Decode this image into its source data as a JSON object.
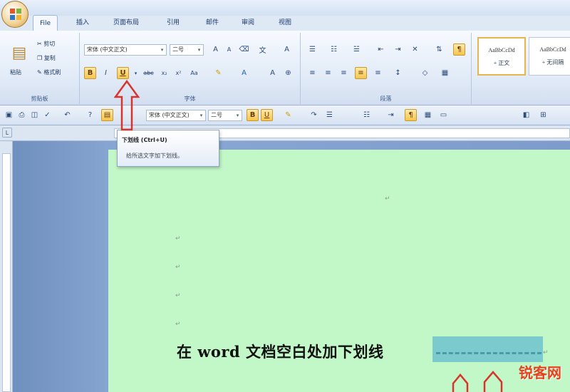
{
  "tabs": {
    "file": "File",
    "insert": "插入",
    "layout": "页面布局",
    "references": "引用",
    "mailings": "邮件",
    "review": "审阅",
    "view": "视图"
  },
  "clipboard": {
    "paste": "粘贴",
    "cut": "剪切",
    "copy": "复制",
    "format_painter": "格式刷",
    "group_label": "剪贴板"
  },
  "font": {
    "name": "宋体 (中文正文)",
    "size": "二号",
    "group_label": "字体",
    "bold": "B",
    "italic": "I",
    "underline": "U",
    "strike": "abc",
    "subscript": "x₂",
    "superscript": "x²",
    "case": "Aa",
    "grow": "A",
    "shrink": "A"
  },
  "paragraph": {
    "group_label": "段落"
  },
  "styles": {
    "normal_sample": "AaBbCcDd",
    "normal_label": "+ 正文",
    "nospacing_sample": "AaBbCcDd",
    "nospacing_label": "+ 无间隔"
  },
  "quickbar": {
    "font_name": "宋体 (中文正文)",
    "font_size": "二号"
  },
  "tooltip": {
    "title": "下划线 (Ctrl+U)",
    "desc": "给所选文字加下划线。"
  },
  "document": {
    "text": "在 word 文档空白处加下划线",
    "para_mark": "↵"
  },
  "watermark": "锐客网",
  "colors": {
    "highlight": "#f7c44c",
    "page": "#c2f7c8",
    "selection": "#6fc3cf",
    "arrow": "#d9342b"
  }
}
